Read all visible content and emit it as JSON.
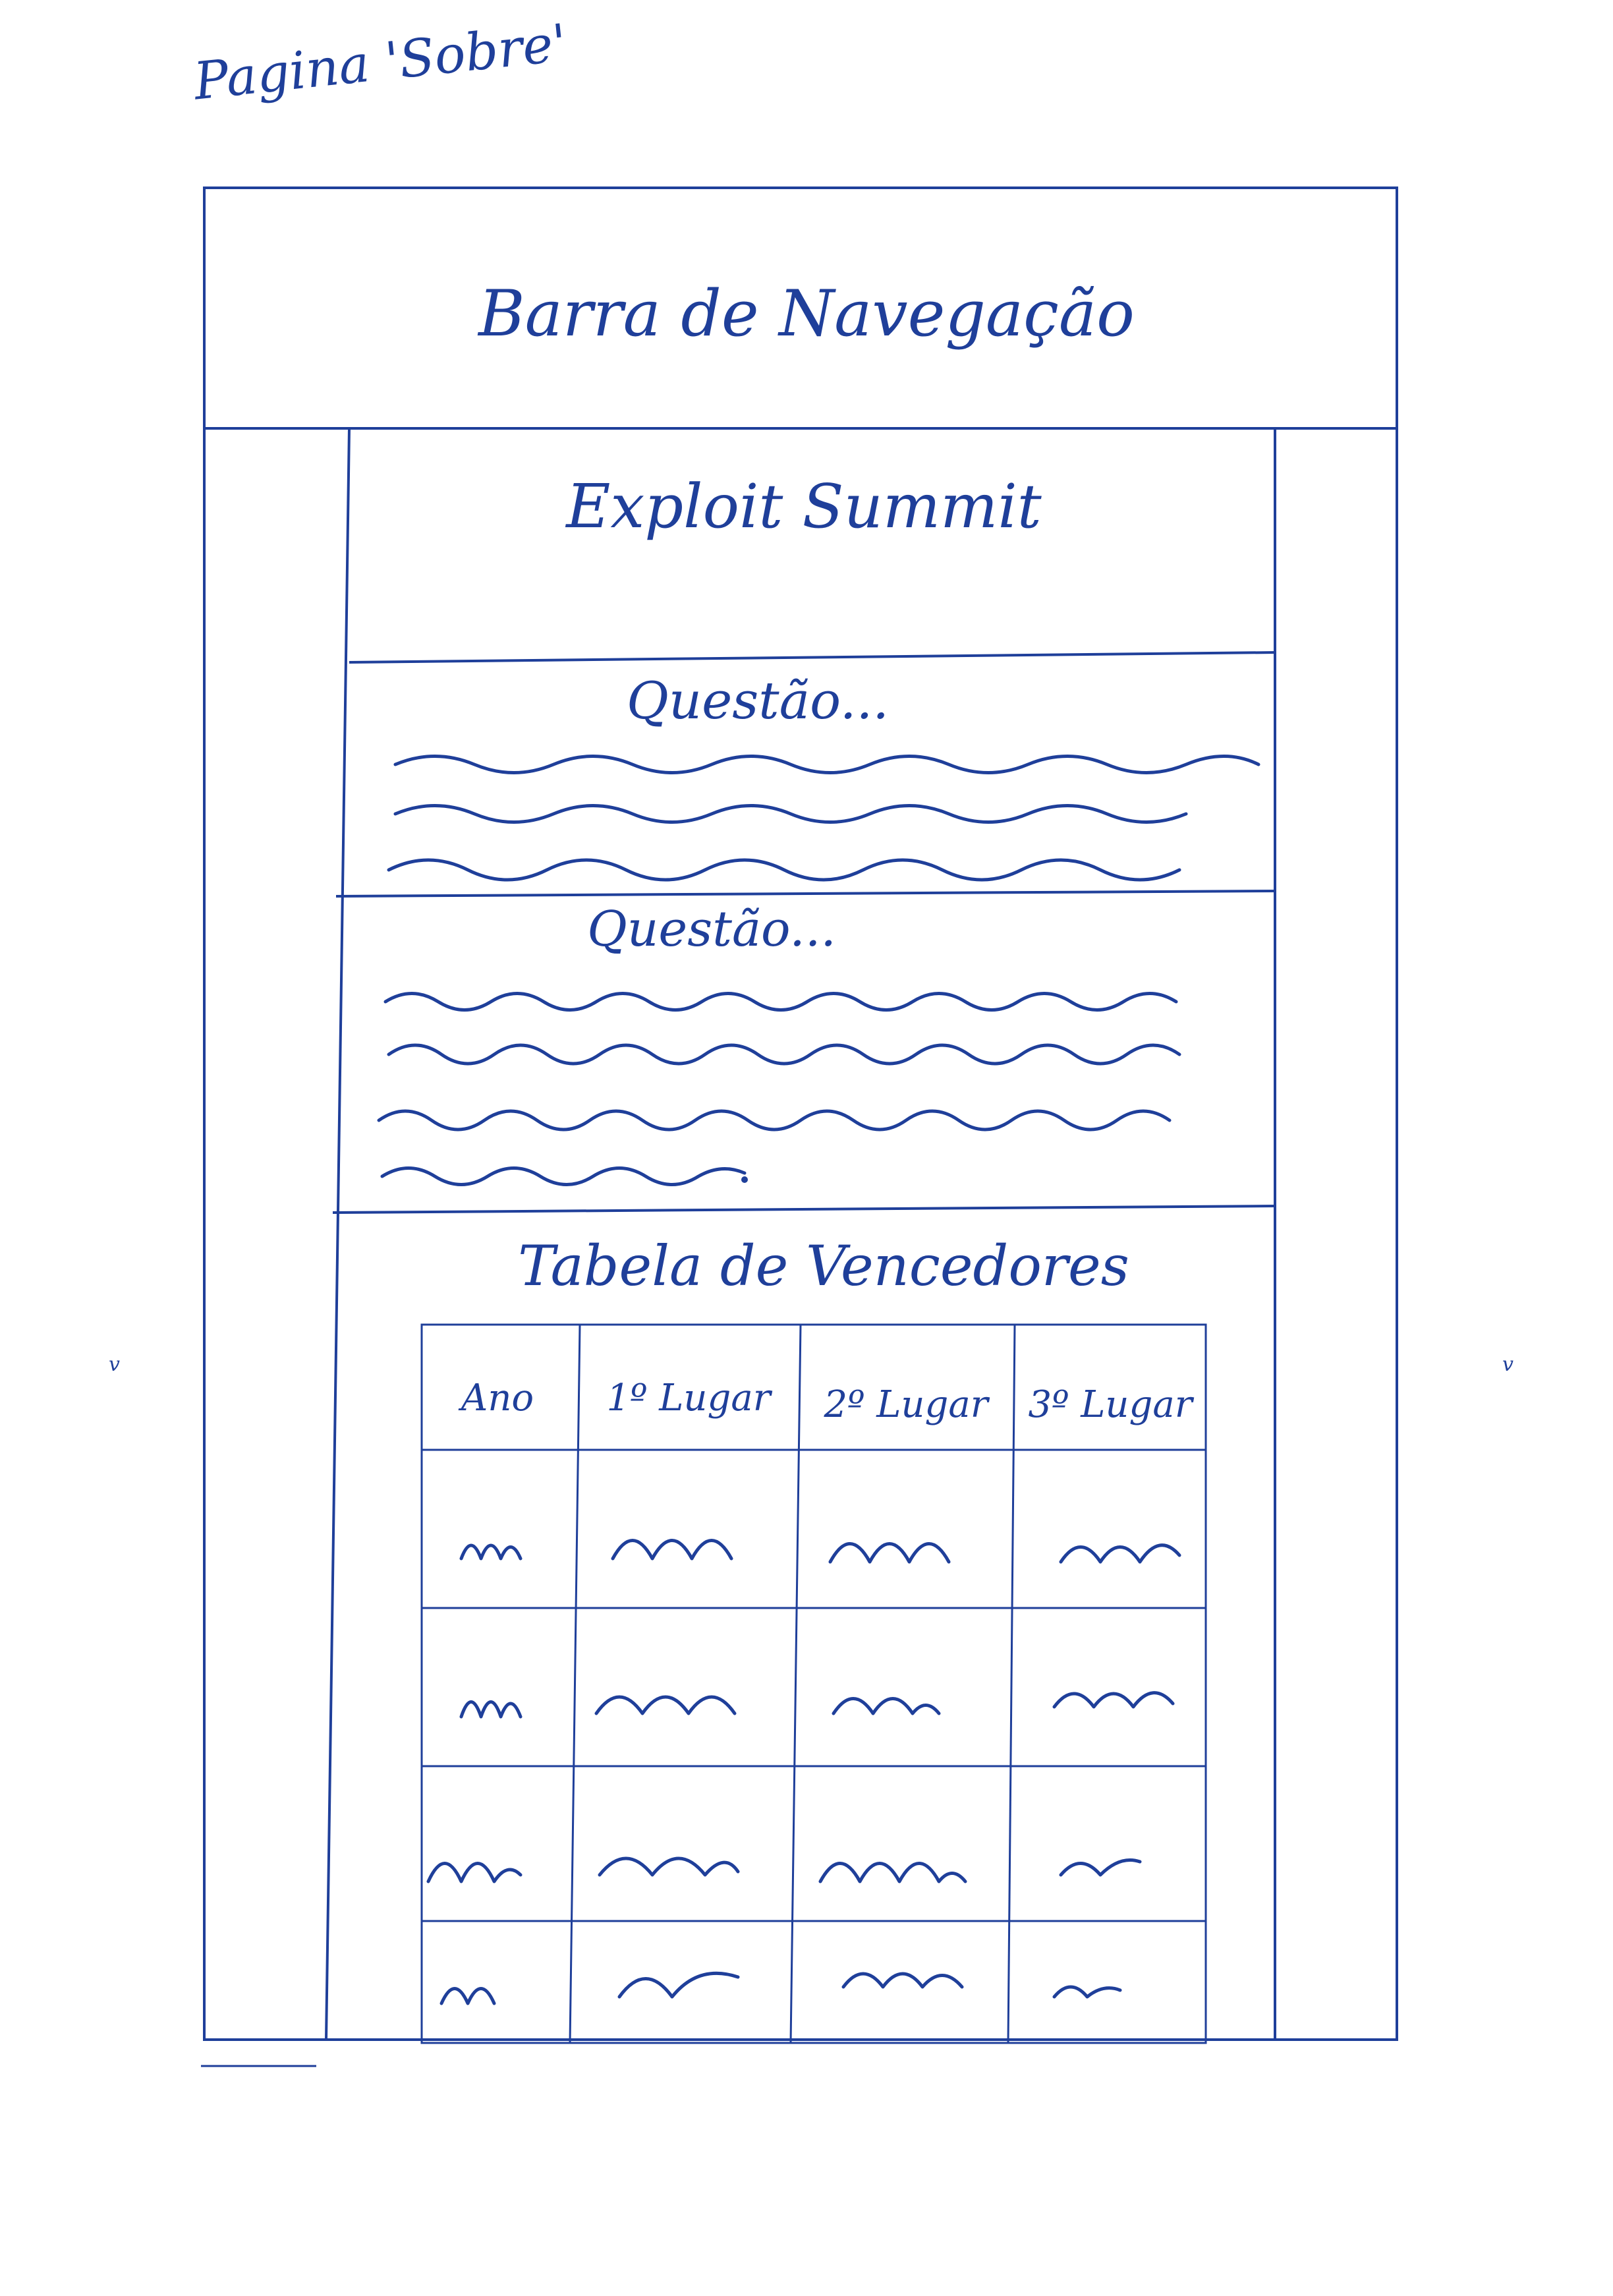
{
  "page_title": "Pagina 'Sobre'",
  "navbar": {
    "label": "Barra de Navegação"
  },
  "hero": {
    "title": "Exploit Summit"
  },
  "sections": [
    {
      "heading": "Questão...",
      "text_lines": 3
    },
    {
      "heading": "Questão...",
      "text_lines": 4
    }
  ],
  "winners_table": {
    "title": "Tabela de Vencedores",
    "columns": [
      "Ano",
      "1º Lugar",
      "2º Lugar",
      "3º Lugar"
    ],
    "row_count": 4
  },
  "ink_color": "#1f3f9a"
}
